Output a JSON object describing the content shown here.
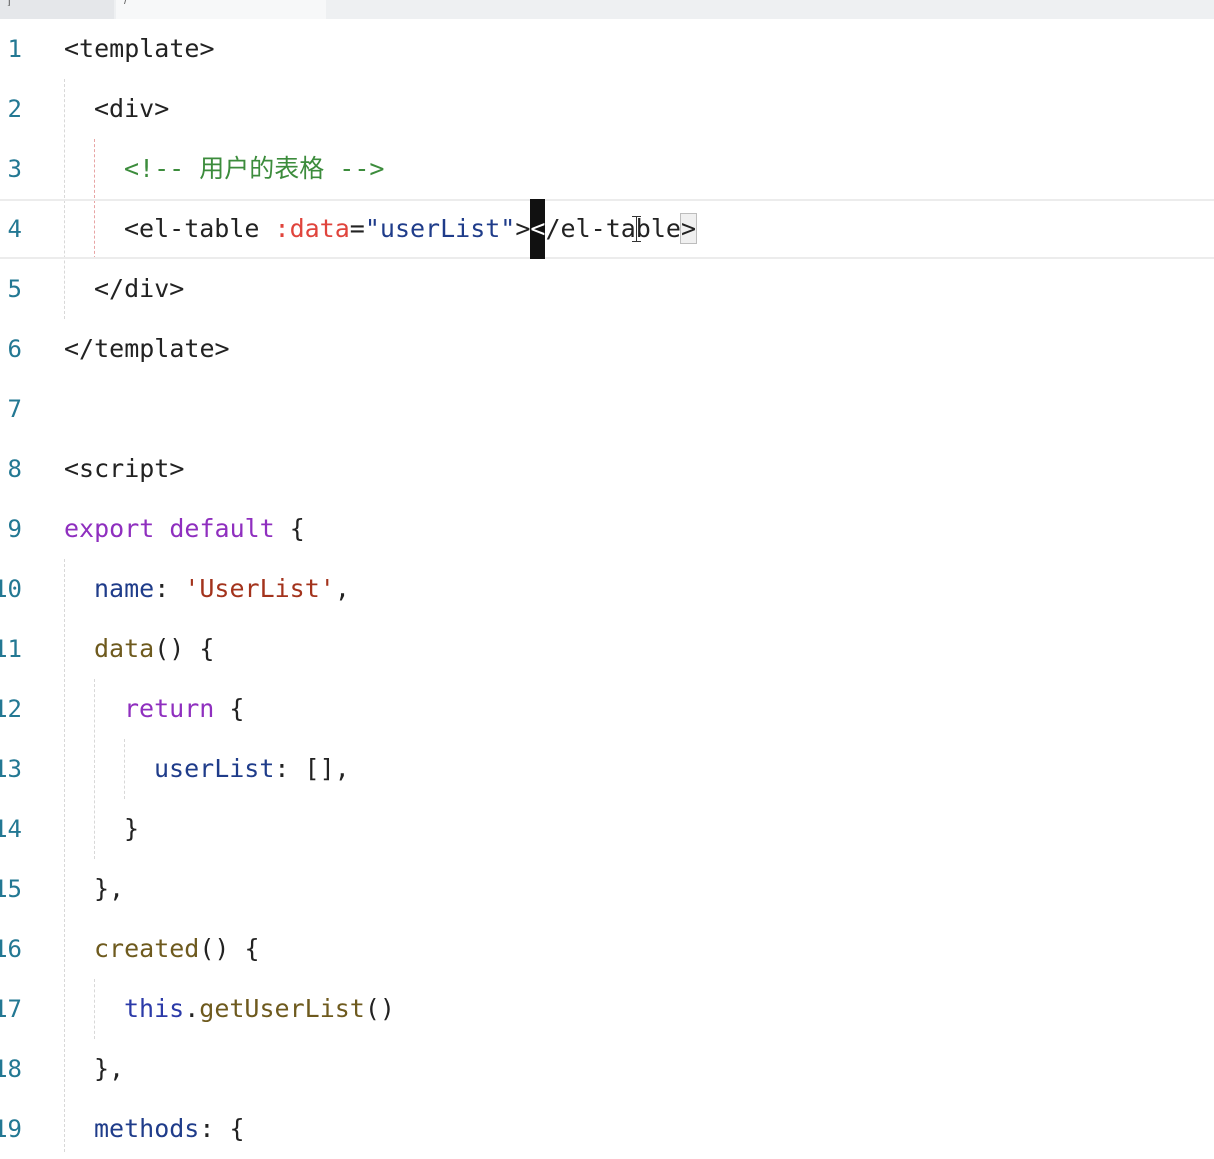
{
  "tabs": [
    {
      "label": "j"
    },
    {
      "label": "/"
    }
  ],
  "cursor_line": 4,
  "lines": [
    {
      "n": "1",
      "tokens": [
        {
          "t": "<template>",
          "c": "tag"
        }
      ]
    },
    {
      "n": "2",
      "tokens": [
        {
          "t": "<div>",
          "c": "tag"
        }
      ]
    },
    {
      "n": "3",
      "tokens": [
        {
          "t": "<!-- 用户的表格 -->",
          "c": "comment"
        }
      ]
    },
    {
      "n": "4",
      "tokens": [
        {
          "t": "<el-table ",
          "c": "tag"
        },
        {
          "t": ":data",
          "c": "attr"
        },
        {
          "t": "=",
          "c": "punc"
        },
        {
          "t": "\"userList\"",
          "c": "str"
        },
        {
          "t": ">",
          "c": "tag"
        },
        {
          "t": "<",
          "c": "cursor"
        },
        {
          "t": "/el-table",
          "c": "tag"
        },
        {
          "t": ">",
          "c": "bracket"
        }
      ]
    },
    {
      "n": "5",
      "tokens": [
        {
          "t": "</div>",
          "c": "tag"
        }
      ]
    },
    {
      "n": "6",
      "tokens": [
        {
          "t": "</template>",
          "c": "tag"
        }
      ]
    },
    {
      "n": "7",
      "tokens": []
    },
    {
      "n": "8",
      "tokens": [
        {
          "t": "<script>",
          "c": "tag"
        }
      ]
    },
    {
      "n": "9",
      "tokens": [
        {
          "t": "export default",
          "c": "kw"
        },
        {
          "t": " {",
          "c": "punc"
        }
      ]
    },
    {
      "n": "10",
      "tokens": [
        {
          "t": "name",
          "c": "prop"
        },
        {
          "t": ": ",
          "c": "punc"
        },
        {
          "t": "'UserList'",
          "c": "strq"
        },
        {
          "t": ",",
          "c": "punc"
        }
      ]
    },
    {
      "n": "11",
      "tokens": [
        {
          "t": "data",
          "c": "fn"
        },
        {
          "t": "() {",
          "c": "punc"
        }
      ]
    },
    {
      "n": "12",
      "tokens": [
        {
          "t": "return",
          "c": "kw"
        },
        {
          "t": " {",
          "c": "punc"
        }
      ]
    },
    {
      "n": "13",
      "tokens": [
        {
          "t": "userList",
          "c": "prop"
        },
        {
          "t": ": [],",
          "c": "punc"
        }
      ]
    },
    {
      "n": "14",
      "tokens": [
        {
          "t": "}",
          "c": "punc"
        }
      ]
    },
    {
      "n": "15",
      "tokens": [
        {
          "t": "},",
          "c": "punc"
        }
      ]
    },
    {
      "n": "16",
      "tokens": [
        {
          "t": "created",
          "c": "fn"
        },
        {
          "t": "() {",
          "c": "punc"
        }
      ]
    },
    {
      "n": "17",
      "tokens": [
        {
          "t": "this",
          "c": "this"
        },
        {
          "t": ".",
          "c": "punc"
        },
        {
          "t": "getUserList",
          "c": "fn"
        },
        {
          "t": "()",
          "c": "punc"
        }
      ]
    },
    {
      "n": "18",
      "tokens": [
        {
          "t": "},",
          "c": "punc"
        }
      ]
    },
    {
      "n": "19",
      "tokens": [
        {
          "t": "methods",
          "c": "prop"
        },
        {
          "t": ": {",
          "c": "punc"
        }
      ]
    }
  ]
}
